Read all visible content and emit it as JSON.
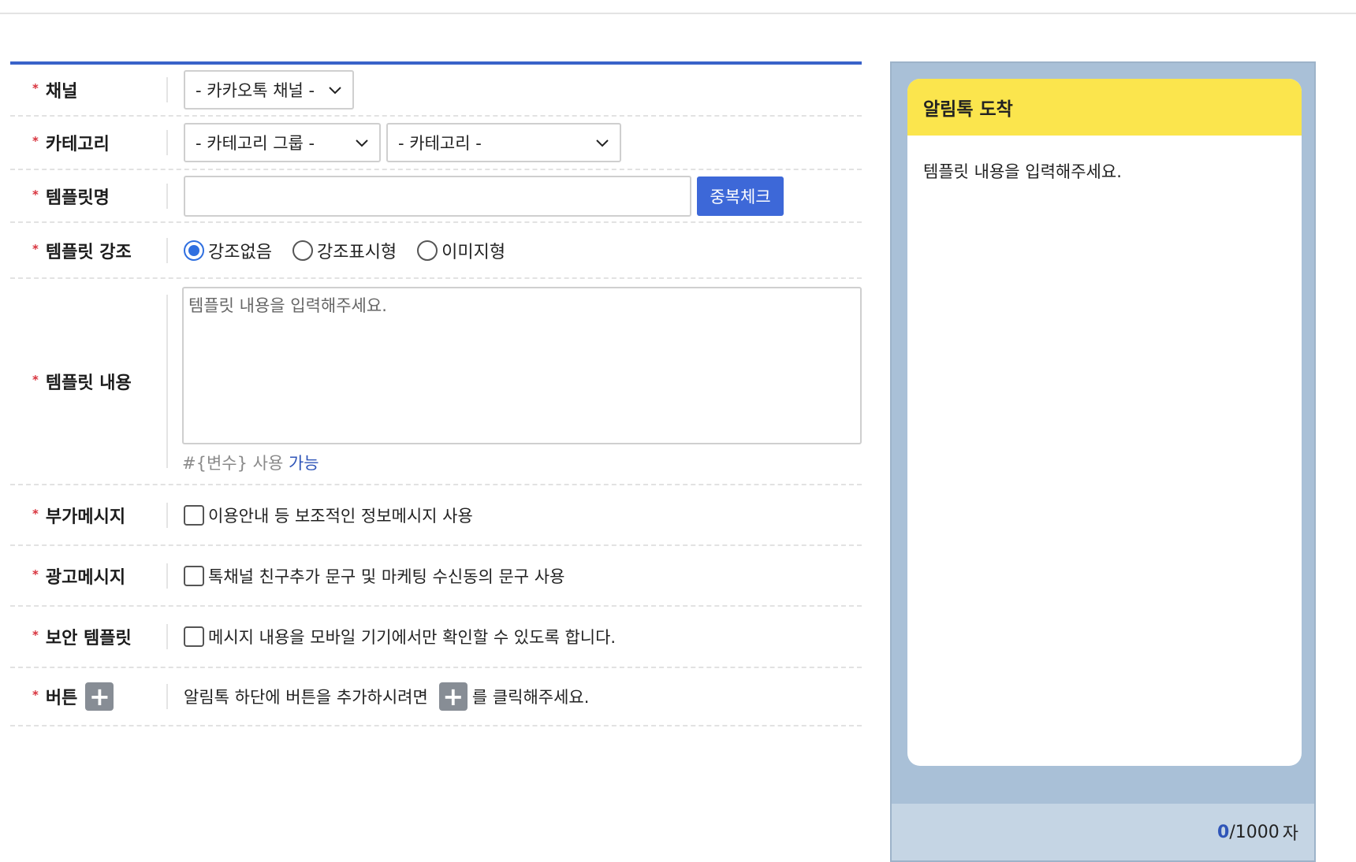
{
  "form": {
    "channel": {
      "label": "채널",
      "select": "- 카카오톡 채널 -"
    },
    "category": {
      "label": "카테고리",
      "group_select": "- 카테고리 그룹 -",
      "category_select": "- 카테고리 -"
    },
    "template_name": {
      "label": "템플릿명",
      "value": "",
      "dup_button": "중복체크"
    },
    "emphasis": {
      "label": "템플릿 강조",
      "options": [
        "강조없음",
        "강조표시형",
        "이미지형"
      ],
      "selected": "강조없음"
    },
    "content": {
      "label": "템플릿 내용",
      "placeholder": "템플릿 내용을 입력해주세요.",
      "hint_prefix": "#{변수} 사용",
      "hint_status": "가능"
    },
    "extra_message": {
      "label": "부가메시지",
      "checkbox": "이용안내 등 보조적인 정보메시지 사용",
      "checked": false
    },
    "ad_message": {
      "label": "광고메시지",
      "checkbox": "톡채널 친구추가 문구 및 마케팅 수신동의 문구 사용",
      "checked": false
    },
    "secure_template": {
      "label": "보안 템플릿",
      "checkbox": "메시지 내용을 모바일 기기에서만 확인할 수 있도록 합니다.",
      "checked": false
    },
    "button": {
      "label": "버튼",
      "desc_before": "알림톡 하단에 버튼을 추가하시려면",
      "desc_after": "를 클릭해주세요.",
      "plus_glyph": "+"
    },
    "required_mark": "*"
  },
  "preview": {
    "title": "알림톡 도착",
    "body": "템플릿 내용을 입력해주세요.",
    "count_current": "0",
    "count_separator": "/",
    "count_max": "1000",
    "count_unit": "자"
  },
  "colors": {
    "accent": "#3a63c9",
    "button_blue": "#3d68d8",
    "required": "#d8323c",
    "bubble_header": "#fbe54d",
    "preview_bg": "#a9c0d7"
  }
}
